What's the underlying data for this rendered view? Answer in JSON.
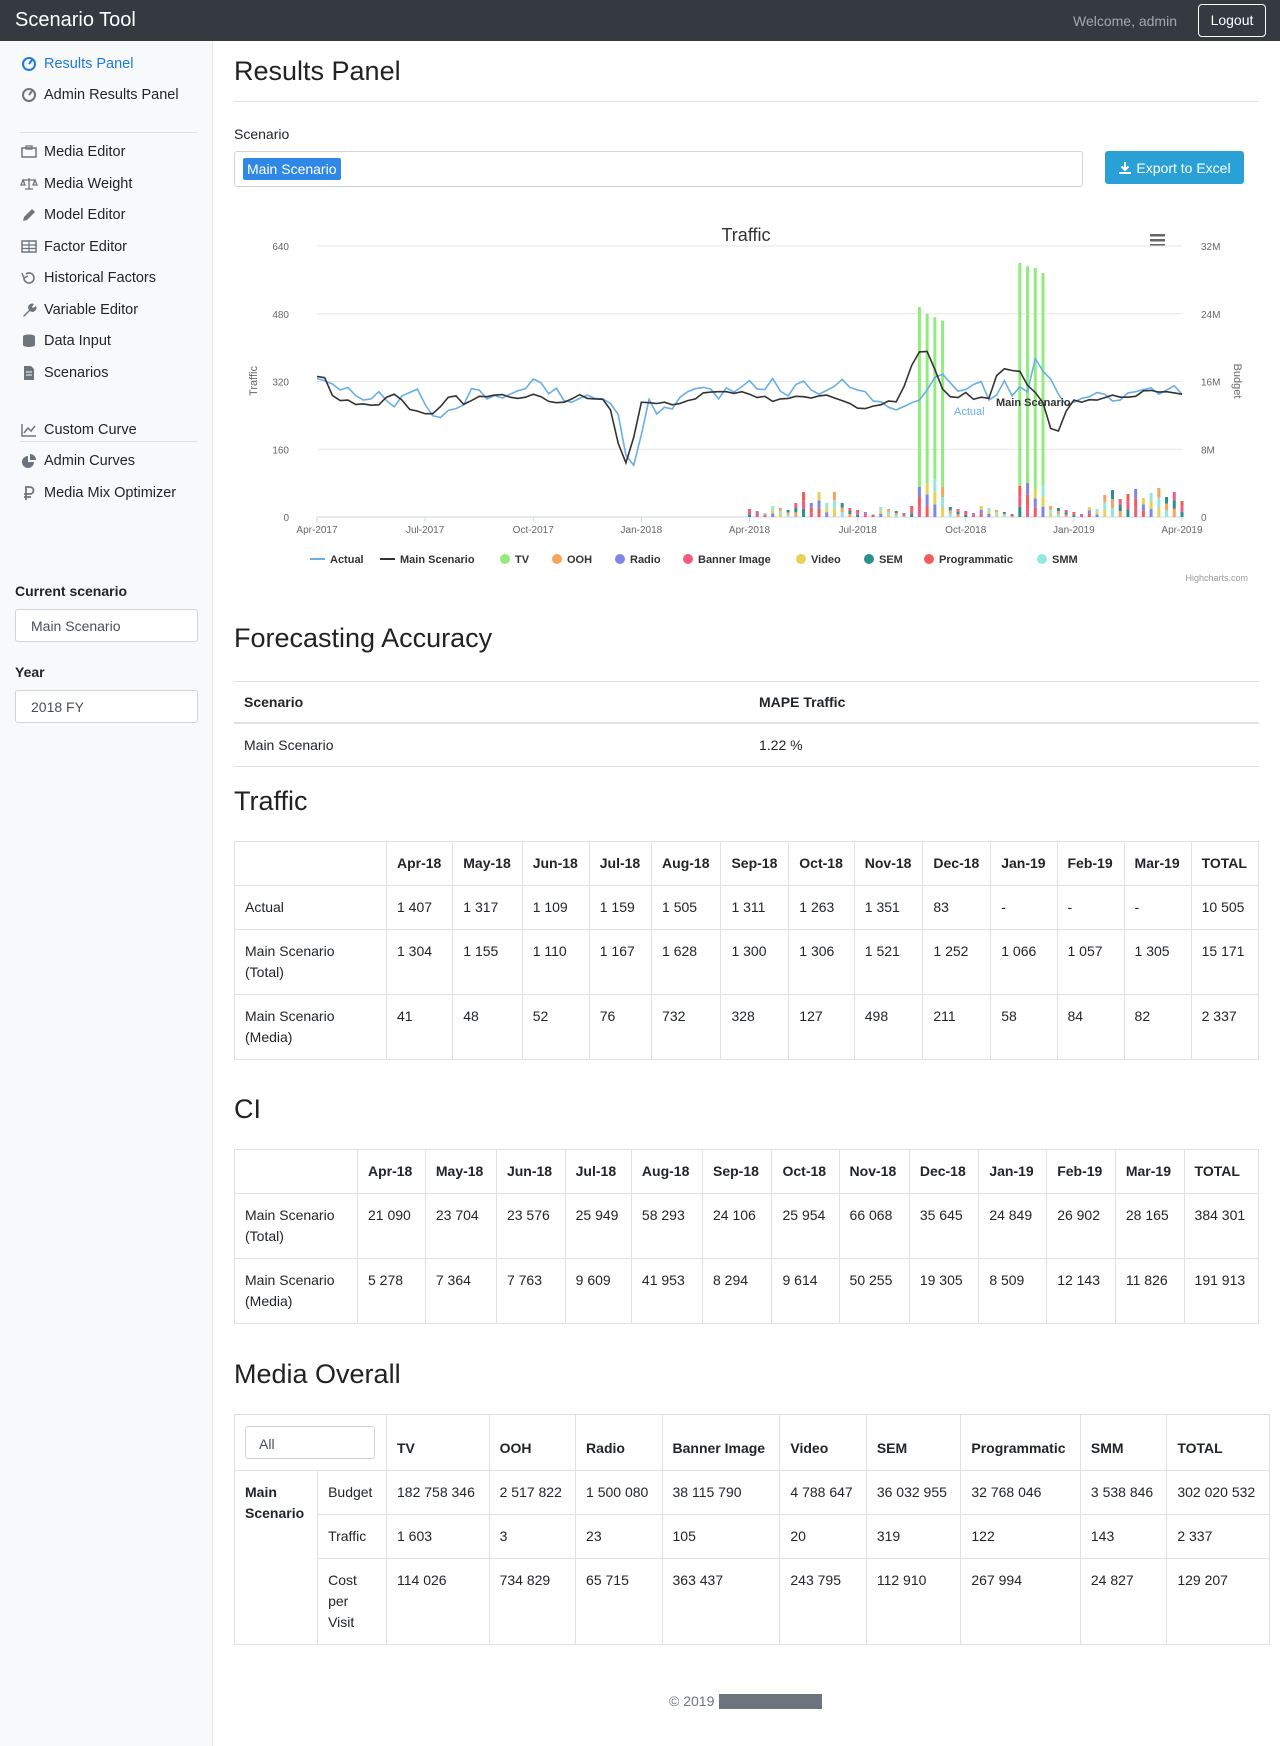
{
  "app": {
    "title": "Scenario Tool",
    "welcome": "Welcome, admin",
    "logout": "Logout"
  },
  "sidebar": {
    "group1": [
      {
        "label": "Results Panel",
        "icon": "dashboard-icon",
        "active": true
      },
      {
        "label": "Admin Results Panel",
        "icon": "dashboard-icon"
      }
    ],
    "group2": [
      {
        "label": "Media Editor",
        "icon": "briefcase-icon"
      },
      {
        "label": "Media Weight",
        "icon": "balance-scale-icon"
      },
      {
        "label": "Model Editor",
        "icon": "pencil-icon"
      },
      {
        "label": "Factor Editor",
        "icon": "table-icon"
      },
      {
        "label": "Historical Factors",
        "icon": "history-icon"
      },
      {
        "label": "Variable Editor",
        "icon": "wrench-icon"
      },
      {
        "label": "Data Input",
        "icon": "database-icon"
      },
      {
        "label": "Scenarios",
        "icon": "file-icon"
      }
    ],
    "group3": [
      {
        "label": "Custom Curve",
        "icon": "line-chart-icon"
      },
      {
        "label": "Admin Curves",
        "icon": "pie-chart-icon"
      },
      {
        "label": "Media Mix Optimizer",
        "icon": "ruble-icon"
      }
    ],
    "current_scenario_label": "Current scenario",
    "current_scenario_value": "Main Scenario",
    "year_label": "Year",
    "year_value": "2018 FY"
  },
  "main": {
    "title": "Results Panel",
    "scenario_label": "Scenario",
    "scenario_selected": "Main Scenario",
    "export_label": "Export to Excel"
  },
  "chart_data": {
    "type": "line",
    "title": "Traffic",
    "ylabel": "Traffic",
    "y2label": "Budget",
    "ylim": [
      0,
      640
    ],
    "y2lim": [
      0,
      32000000
    ],
    "yticks": [
      "0",
      "160",
      "320",
      "480",
      "640"
    ],
    "y2ticks": [
      "0",
      "8M",
      "16M",
      "24M",
      "32M"
    ],
    "xticks": [
      "Apr-2017",
      "Jul-2017",
      "Oct-2017",
      "Jan-2018",
      "Apr-2018",
      "Jul-2018",
      "Oct-2018",
      "Jan-2019",
      "Apr-2019"
    ],
    "series_labels": [
      "Actual",
      "Main Scenario"
    ],
    "legend": [
      {
        "name": "Actual",
        "color": "#6aaee8",
        "kind": "line"
      },
      {
        "name": "Main Scenario",
        "color": "#333333",
        "kind": "line"
      },
      {
        "name": "TV",
        "color": "#90ed7d",
        "kind": "dot"
      },
      {
        "name": "OOH",
        "color": "#f7a35c",
        "kind": "dot"
      },
      {
        "name": "Radio",
        "color": "#8085e9",
        "kind": "dot"
      },
      {
        "name": "Banner Image",
        "color": "#f15c80",
        "kind": "dot"
      },
      {
        "name": "Video",
        "color": "#e4d354",
        "kind": "dot"
      },
      {
        "name": "SEM",
        "color": "#2b908f",
        "kind": "dot"
      },
      {
        "name": "Programmatic",
        "color": "#f45b5b",
        "kind": "dot"
      },
      {
        "name": "SMM",
        "color": "#91e8e1",
        "kind": "dot"
      }
    ],
    "credit": "Highcharts.com",
    "actual": [
      327,
      322,
      314,
      300,
      306,
      287,
      276,
      279,
      296,
      275,
      260,
      286,
      294,
      302,
      266,
      239,
      235,
      252,
      256,
      265,
      303,
      300,
      279,
      287,
      281,
      290,
      298,
      303,
      326,
      317,
      291,
      304,
      275,
      271,
      280,
      288,
      280,
      279,
      268,
      242,
      146,
      122,
      195,
      278,
      243,
      259,
      255,
      283,
      296,
      303,
      306,
      302,
      279,
      305,
      295,
      308,
      322,
      302,
      301,
      327,
      297,
      286,
      313,
      321,
      300,
      290,
      299,
      309,
      325,
      306,
      300,
      296,
      274,
      272,
      259,
      253,
      261,
      270,
      276,
      300,
      330,
      337,
      317,
      297,
      301,
      313,
      320,
      276,
      288,
      322,
      286,
      307,
      296,
      374,
      344,
      326,
      290,
      264,
      271,
      280,
      284,
      294,
      290,
      274,
      276,
      293,
      296,
      301,
      305,
      290,
      300,
      310,
      290
    ],
    "main": [
      332,
      329,
      287,
      275,
      276,
      266,
      267,
      264,
      265,
      283,
      290,
      276,
      254,
      250,
      244,
      244,
      261,
      283,
      286,
      266,
      275,
      285,
      284,
      288,
      289,
      283,
      280,
      283,
      290,
      284,
      273,
      270,
      271,
      279,
      289,
      280,
      279,
      278,
      253,
      174,
      128,
      188,
      271,
      270,
      268,
      271,
      265,
      268,
      275,
      279,
      293,
      295,
      296,
      296,
      292,
      296,
      290,
      282,
      285,
      273,
      279,
      280,
      285,
      284,
      281,
      286,
      288,
      281,
      275,
      268,
      257,
      256,
      262,
      265,
      274,
      272,
      308,
      358,
      390,
      391,
      348,
      302,
      284,
      282,
      294,
      278,
      283,
      280,
      334,
      350,
      346,
      344,
      311,
      294,
      270,
      209,
      203,
      250,
      276,
      271,
      277,
      276,
      282,
      288,
      283,
      283,
      285,
      298,
      299,
      295,
      296,
      293,
      290
    ],
    "tv": [
      0,
      0,
      0,
      0,
      0,
      0,
      0,
      0,
      0,
      0,
      0,
      0,
      0,
      0,
      0,
      0,
      0,
      0,
      0,
      0,
      0,
      0,
      0,
      0,
      0,
      0,
      0,
      0,
      0,
      0,
      0,
      0,
      0,
      0,
      0,
      0,
      0,
      0,
      0,
      0,
      0,
      0,
      0,
      0,
      0,
      0,
      0,
      0,
      0,
      0,
      0,
      0,
      0,
      0,
      0,
      0,
      0,
      0,
      0,
      0,
      0,
      0,
      0,
      0,
      0,
      0,
      0,
      0,
      0,
      0,
      0,
      0,
      0,
      0,
      0,
      0,
      0,
      0,
      24.8,
      24.0,
      23.6,
      23.2,
      0,
      0,
      0,
      0,
      0,
      0,
      0,
      0,
      0,
      30.0,
      29.6,
      29.4,
      28.8,
      0,
      0,
      0,
      0,
      0,
      0,
      0,
      0,
      0,
      0,
      0,
      0,
      0,
      0,
      0,
      0,
      0,
      0
    ]
  },
  "accuracy": {
    "title": "Forecasting Accuracy",
    "headers": [
      "Scenario",
      "MAPE Traffic"
    ],
    "rows": [
      [
        "Main Scenario",
        "1.22 %"
      ]
    ]
  },
  "traffic_table": {
    "title": "Traffic",
    "headers": [
      "",
      "Apr-18",
      "May-18",
      "Jun-18",
      "Jul-18",
      "Aug-18",
      "Sep-18",
      "Oct-18",
      "Nov-18",
      "Dec-18",
      "Jan-19",
      "Feb-19",
      "Mar-19",
      "TOTAL"
    ],
    "rows": [
      [
        "Actual",
        "1 407",
        "1 317",
        "1 109",
        "1 159",
        "1 505",
        "1 311",
        "1 263",
        "1 351",
        "83",
        "-",
        "-",
        "-",
        "10 505"
      ],
      [
        "Main Scenario (Total)",
        "1 304",
        "1 155",
        "1 110",
        "1 167",
        "1 628",
        "1 300",
        "1 306",
        "1 521",
        "1 252",
        "1 066",
        "1 057",
        "1 305",
        "15 171"
      ],
      [
        "Main Scenario (Media)",
        "41",
        "48",
        "52",
        "76",
        "732",
        "328",
        "127",
        "498",
        "211",
        "58",
        "84",
        "82",
        "2 337"
      ]
    ]
  },
  "ci_table": {
    "title": "CI",
    "headers": [
      "",
      "Apr-18",
      "May-18",
      "Jun-18",
      "Jul-18",
      "Aug-18",
      "Sep-18",
      "Oct-18",
      "Nov-18",
      "Dec-18",
      "Jan-19",
      "Feb-19",
      "Mar-19",
      "TOTAL"
    ],
    "rows": [
      [
        "Main Scenario (Total)",
        "21 090",
        "23 704",
        "23 576",
        "25 949",
        "58 293",
        "24 106",
        "25 954",
        "66 068",
        "35 645",
        "24 849",
        "26 902",
        "28 165",
        "384 301"
      ],
      [
        "Main Scenario (Media)",
        "5 278",
        "7 364",
        "7 763",
        "9 609",
        "41 953",
        "8 294",
        "9 614",
        "50 255",
        "19 305",
        "8 509",
        "12 143",
        "11 826",
        "191 913"
      ]
    ]
  },
  "media_table": {
    "title": "Media Overall",
    "filter_value": "All",
    "headers": [
      "TV",
      "OOH",
      "Radio",
      "Banner Image",
      "Video",
      "SEM",
      "Programmatic",
      "SMM",
      "TOTAL"
    ],
    "group": "Main Scenario",
    "rows": [
      {
        "metric": "Budget",
        "values": [
          "182 758 346",
          "2 517 822",
          "1 500 080",
          "38 115 790",
          "4 788 647",
          "36 032 955",
          "32 768 046",
          "3 538 846",
          "302 020 532"
        ]
      },
      {
        "metric": "Traffic",
        "values": [
          "1 603",
          "3",
          "23",
          "105",
          "20",
          "319",
          "122",
          "143",
          "2 337"
        ]
      },
      {
        "metric": "Cost per Visit",
        "values": [
          "114 026",
          "734 829",
          "65 715",
          "363 437",
          "243 795",
          "112 910",
          "267 994",
          "24 827",
          "129 207"
        ]
      }
    ]
  },
  "footer": {
    "copyright": "© 2019"
  }
}
